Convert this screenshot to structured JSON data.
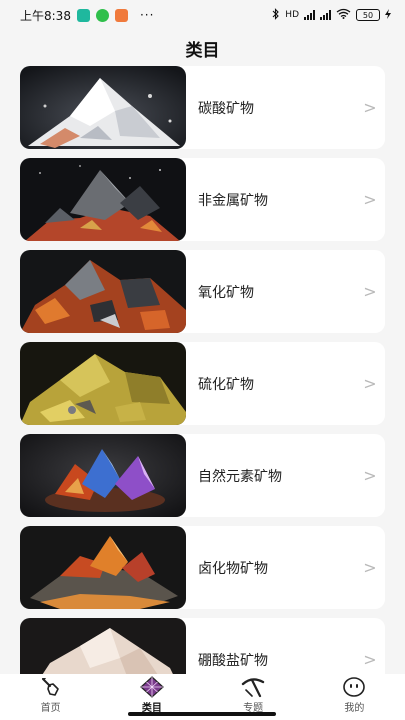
{
  "status_bar": {
    "time": "上午8:38",
    "more": "···",
    "battery": "50",
    "network": "HD"
  },
  "header": {
    "title": "类目"
  },
  "categories": [
    {
      "label": "碳酸矿物",
      "icon": "chevron-right-icon"
    },
    {
      "label": "非金属矿物",
      "icon": "chevron-right-icon"
    },
    {
      "label": "氧化矿物",
      "icon": "chevron-right-icon"
    },
    {
      "label": "硫化矿物",
      "icon": "chevron-right-icon"
    },
    {
      "label": "自然元素矿物",
      "icon": "chevron-right-icon"
    },
    {
      "label": "卤化物矿物",
      "icon": "chevron-right-icon"
    },
    {
      "label": "硼酸盐矿物",
      "icon": "chevron-right-icon"
    }
  ],
  "chevron_glyph": ">",
  "tabs": [
    {
      "label": "首页",
      "icon": "shovel-icon",
      "active": false
    },
    {
      "label": "类目",
      "icon": "gem-icon",
      "active": true
    },
    {
      "label": "专题",
      "icon": "pickaxe-icon",
      "active": false
    },
    {
      "label": "我的",
      "icon": "face-icon",
      "active": false
    }
  ],
  "colors": {
    "active_tab": "#7a3a8c",
    "background": "#f5f5f5",
    "card": "#ffffff"
  }
}
